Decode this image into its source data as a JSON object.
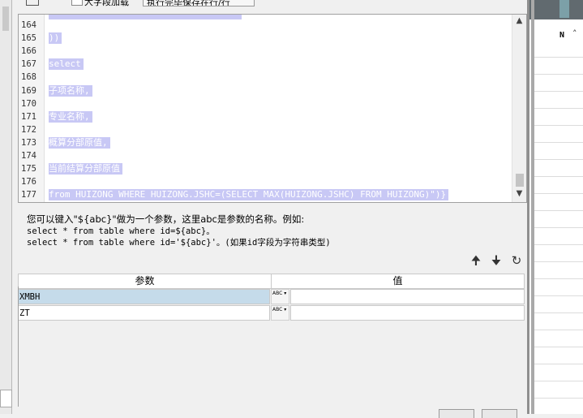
{
  "toolbar": {
    "checkbox_label": "大字段加载",
    "select_value": "执行完毕保存在行/行"
  },
  "editor": {
    "lines": [
      {
        "num": "164",
        "code": ""
      },
      {
        "num": "165",
        "code": "))"
      },
      {
        "num": "166",
        "code": ""
      },
      {
        "num": "167",
        "code": "select "
      },
      {
        "num": "168",
        "code": ""
      },
      {
        "num": "169",
        "code": "子项名称,"
      },
      {
        "num": "170",
        "code": ""
      },
      {
        "num": "171",
        "code": "专业名称,"
      },
      {
        "num": "172",
        "code": ""
      },
      {
        "num": "173",
        "code": "概算分部原值,"
      },
      {
        "num": "174",
        "code": ""
      },
      {
        "num": "175",
        "code": "当前结算分部原值"
      },
      {
        "num": "176",
        "code": ""
      },
      {
        "num": "177",
        "code": "from HUIZONG WHERE HUIZONG.JSHC=(SELECT MAX(HUIZONG.JSHC) FROM HUIZONG)\")}"
      }
    ],
    "scroll_up_icon": "triangle-up-icon",
    "scroll_down_icon": "triangle-down-icon"
  },
  "help": {
    "line1": "您可以键入\"${abc}\"做为一个参数，这里abc是参数的名称。例如:",
    "line2": "select * from table where id=${abc}。",
    "line3": "select * from table where id='${abc}'。(如果id字段为字符串类型)"
  },
  "actions": {
    "up_icon": "arrow-up-icon",
    "down_icon": "arrow-down-icon",
    "refresh_icon": "refresh-icon"
  },
  "params": {
    "col_param": "参数",
    "col_value": "值",
    "rows": [
      {
        "name": "XMBH",
        "type": "ABC",
        "value": ""
      },
      {
        "name": "ZT",
        "type": "ABC",
        "value": ""
      }
    ]
  },
  "right_panel": {
    "header": "N"
  },
  "colors": {
    "selection": "#c8c8f5",
    "row_selected": "#c5dbea"
  }
}
